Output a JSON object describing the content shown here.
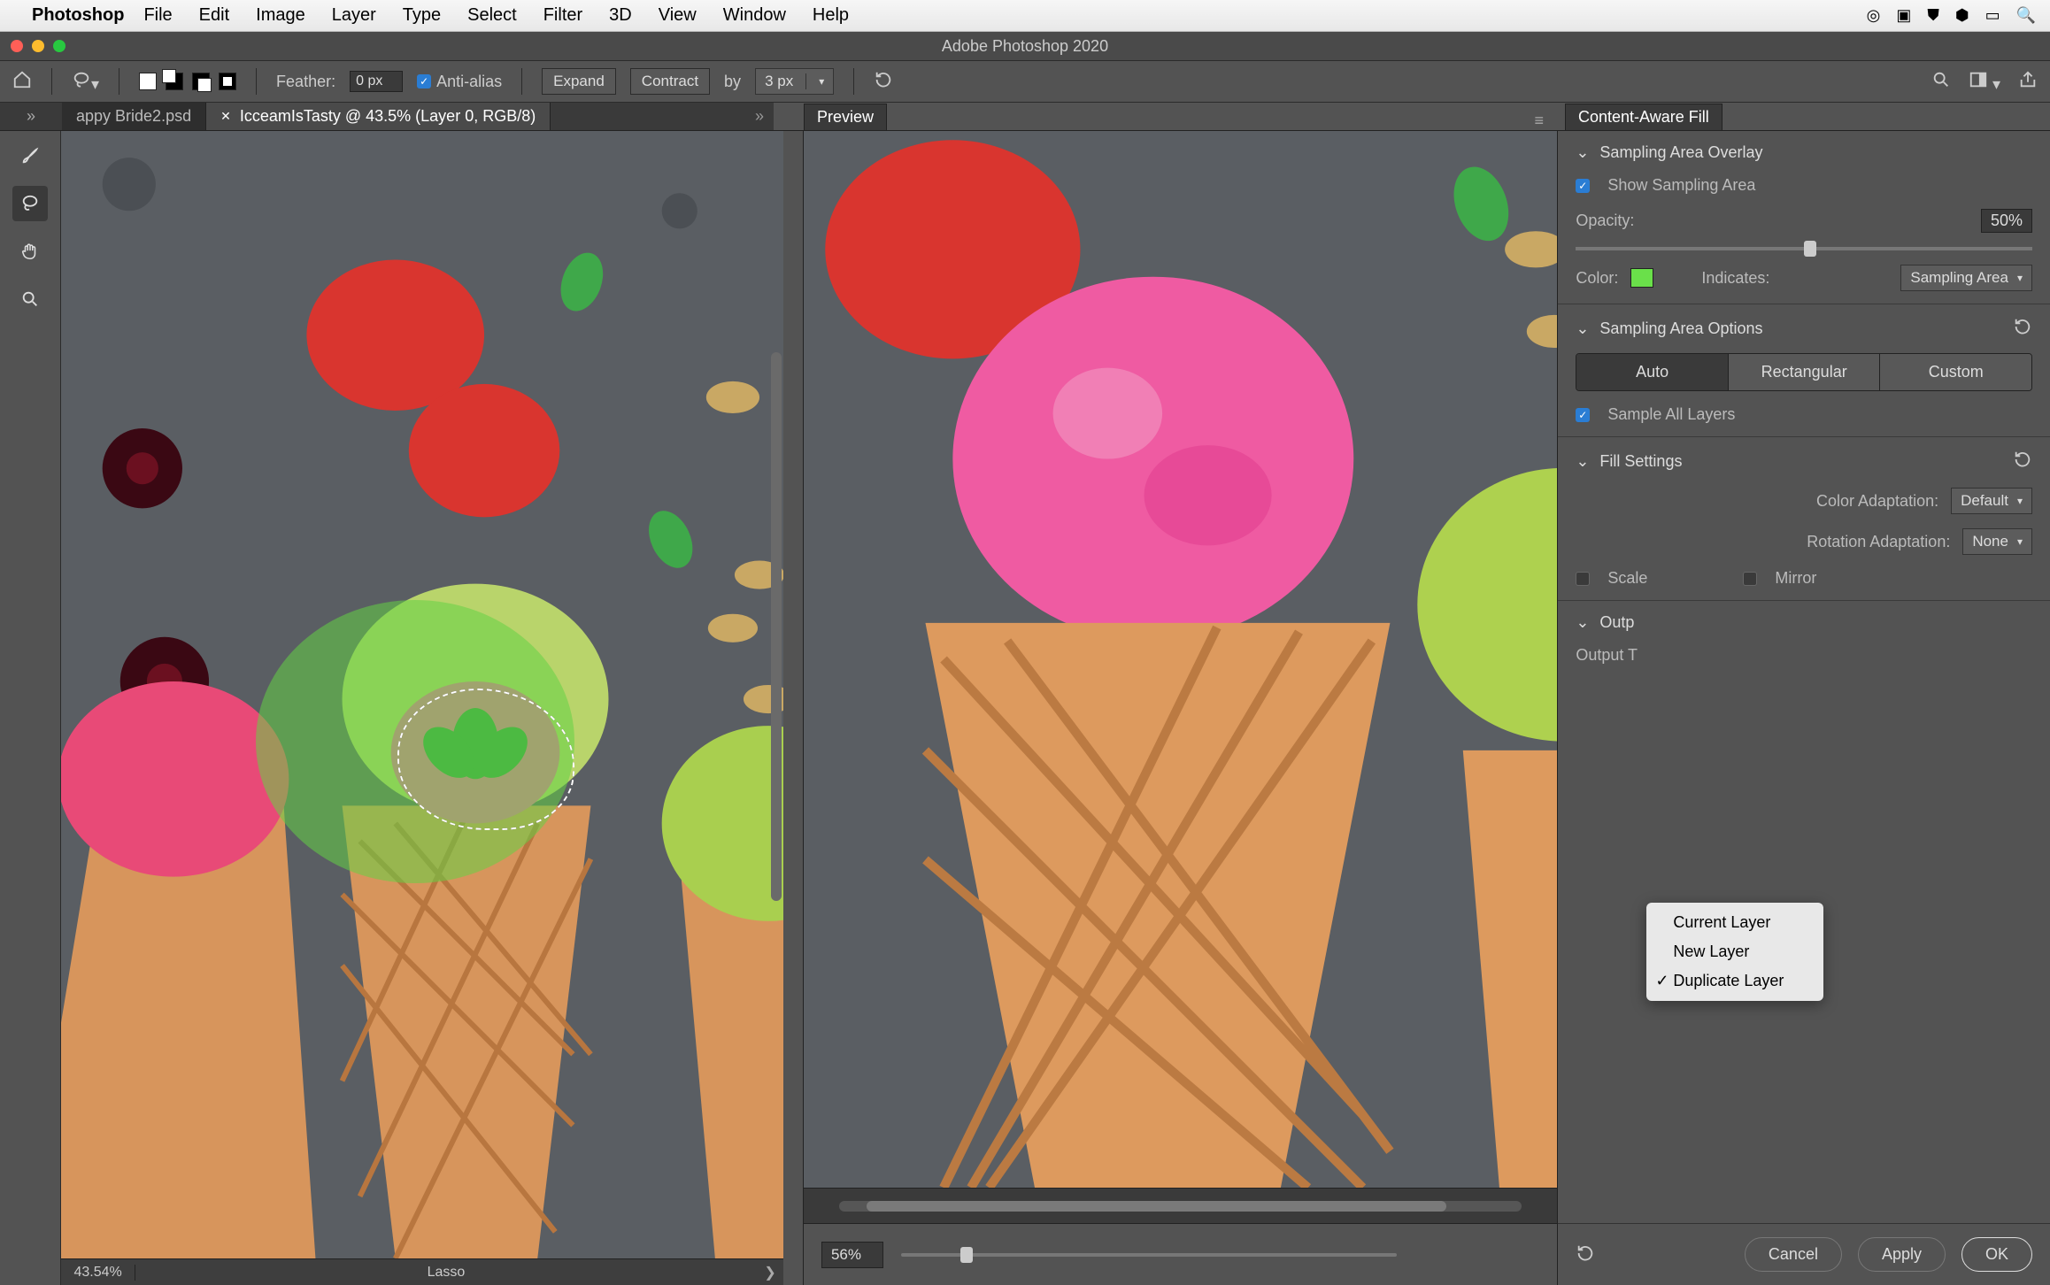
{
  "menubar": {
    "app": "Photoshop",
    "items": [
      "File",
      "Edit",
      "Image",
      "Layer",
      "Type",
      "Select",
      "Filter",
      "3D",
      "View",
      "Window",
      "Help"
    ]
  },
  "window_title": "Adobe Photoshop 2020",
  "options": {
    "feather_label": "Feather:",
    "feather_value": "0 px",
    "antialias_label": "Anti-alias",
    "expand": "Expand",
    "contract": "Contract",
    "by_label": "by",
    "by_value": "3 px"
  },
  "tabs": [
    {
      "label": "appy Bride2.psd",
      "active": false
    },
    {
      "label": "IcceamIsTasty @ 43.5% (Layer 0, RGB/8)",
      "active": true
    }
  ],
  "preview_panel_title": "Preview",
  "right_panel_title": "Content-Aware Fill",
  "status": {
    "zoom": "43.54%",
    "tool": "Lasso"
  },
  "preview": {
    "zoom": "56%"
  },
  "caf": {
    "sec_overlay": "Sampling Area Overlay",
    "show_sampling": "Show Sampling Area",
    "opacity_label": "Opacity:",
    "opacity_value": "50%",
    "color_label": "Color:",
    "indicates_label": "Indicates:",
    "indicates_value": "Sampling Area",
    "sec_options": "Sampling Area Options",
    "seg": {
      "auto": "Auto",
      "rect": "Rectangular",
      "custom": "Custom"
    },
    "sample_all": "Sample All Layers",
    "sec_fill": "Fill Settings",
    "color_adapt_label": "Color Adaptation:",
    "color_adapt_value": "Default",
    "rotation_label": "Rotation Adaptation:",
    "rotation_value": "None",
    "scale": "Scale",
    "mirror": "Mirror",
    "sec_output": "Outp",
    "output_to_label": "Output T",
    "popup": {
      "current": "Current Layer",
      "new": "New Layer",
      "dup": "Duplicate Layer"
    }
  },
  "footer": {
    "cancel": "Cancel",
    "apply": "Apply",
    "ok": "OK"
  }
}
